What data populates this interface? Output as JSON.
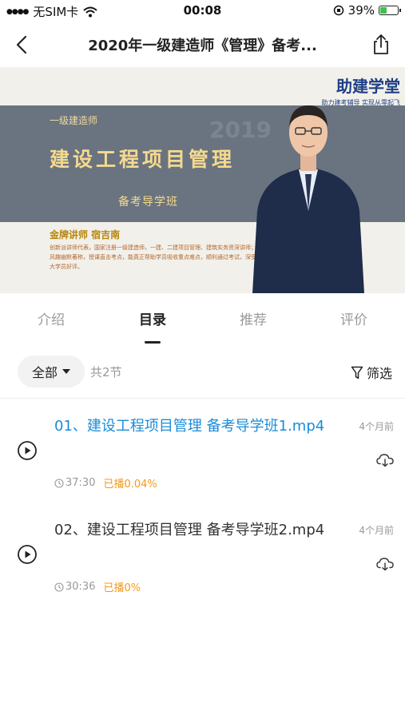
{
  "status_bar": {
    "carrier": "无SIM卡",
    "time": "00:08",
    "battery": "39%",
    "battery_level": 0.39
  },
  "nav": {
    "title": "2020年一级建造师《管理》备考..."
  },
  "banner": {
    "brand": "助建学堂",
    "slogan": "助力建考辅导  实现从零起飞",
    "watermark": "2019",
    "subtitle": "一级建造师",
    "title": "建设工程项目管理",
    "class_name": "备考导学班",
    "teacher": "金牌讲师  宿吉南",
    "description": "创新派讲师代表，国家注册一级建造师，一建、二建项目管理、建筑实务资深讲师；以风趣幽默著称，授课直击考点，能真正帮助学员吸收重点难点，顺利通过考试，深受广大学员好评。"
  },
  "tabs": [
    {
      "label": "介绍",
      "active": false
    },
    {
      "label": "目录",
      "active": true
    },
    {
      "label": "推荐",
      "active": false
    },
    {
      "label": "评价",
      "active": false
    }
  ],
  "filter": {
    "all_label": "全部",
    "count_label": "共2节",
    "filter_label": "筛选"
  },
  "lessons": [
    {
      "title": "01、建设工程项目管理 备考导学班1.mp4",
      "duration": "37:30",
      "progress": "已播0.04%",
      "time_ago": "4个月前",
      "active": true
    },
    {
      "title": "02、建设工程项目管理 备考导学班2.mp4",
      "duration": "30:36",
      "progress": "已播0%",
      "time_ago": "4个月前",
      "active": false
    }
  ],
  "colors": {
    "accent_blue": "#1a8cd8",
    "progress_orange": "#f39a1e",
    "battery_green": "#3bc34a",
    "banner_gold": "#f5d98d",
    "banner_band": "#6a7480"
  }
}
